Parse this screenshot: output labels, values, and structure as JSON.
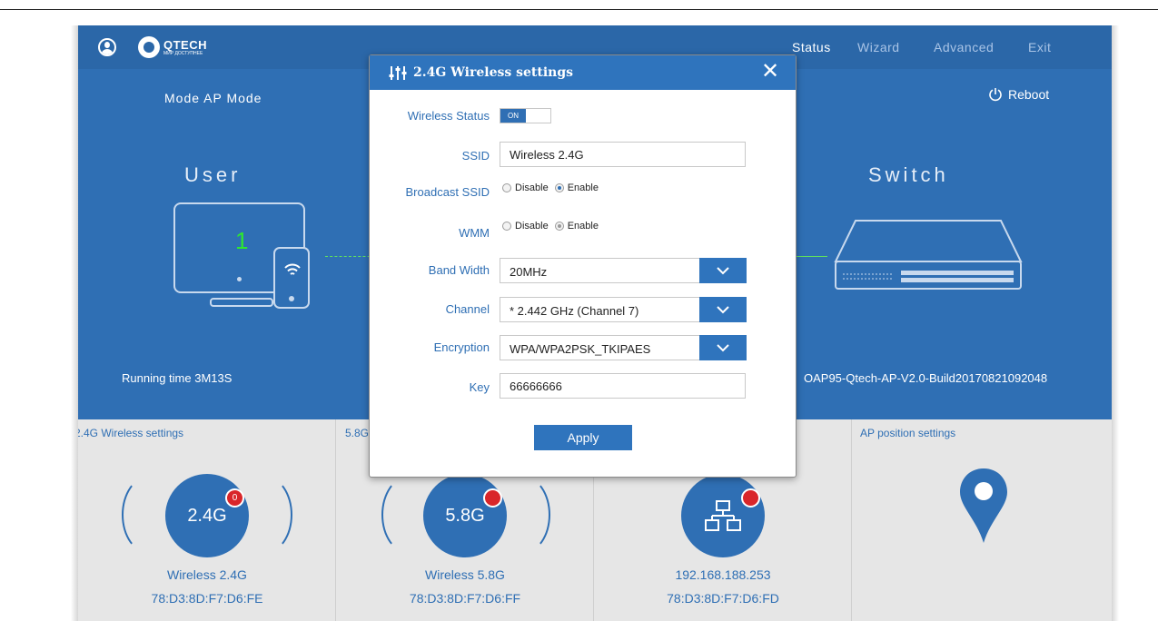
{
  "header": {
    "logo_text": "QTECH",
    "logo_slogan": "МИР ДОСТУПНЕЕ",
    "nav": [
      "Status",
      "Wizard",
      "Advanced",
      "Exit"
    ],
    "active_nav": "Status"
  },
  "status": {
    "mode_label": "Mode  AP Mode",
    "reboot_label": "Reboot",
    "user_title": "User",
    "switch_title": "Switch",
    "user_count": "1",
    "running_time": "Running time  3M13S",
    "firmware": "OAP95-Qtech-AP-V2.0-Build20170821092048"
  },
  "panels": [
    {
      "title": "2.4G Wireless settings",
      "circle": "2.4G",
      "badge": "0",
      "name": "Wireless 2.4G",
      "mac": "78:D3:8D:F7:D6:FE"
    },
    {
      "title": "5.8G",
      "circle": "5.8G",
      "name": "Wireless 5.8G",
      "mac": "78:D3:8D:F7:D6:FF"
    },
    {
      "name": "192.168.188.253",
      "mac": "78:D3:8D:F7:D6:FD"
    },
    {
      "title": "AP position settings"
    }
  ],
  "modal": {
    "title": "2.4G Wireless settings",
    "close_glyph": "✕",
    "wireless_status_label": "Wireless Status",
    "wireless_status_value": "ON",
    "ssid_label": "SSID",
    "ssid_value": "Wireless 2.4G",
    "broadcast_label": "Broadcast SSID",
    "broadcast_options": [
      "Disable",
      "Enable"
    ],
    "broadcast_selected": "Enable",
    "wmm_label": "WMM",
    "wmm_options": [
      "Disable",
      "Enable"
    ],
    "wmm_selected": "Enable",
    "bandwidth_label": "Band Width",
    "bandwidth_value": "20MHz",
    "channel_label": "Channel",
    "channel_value": "* 2.442 GHz (Channel 7)",
    "encryption_label": "Encryption",
    "encryption_value": "WPA/WPA2PSK_TKIPAES",
    "key_label": "Key",
    "key_value": "66666666",
    "apply_label": "Apply"
  },
  "colors": {
    "primary_blue": "#2f6fb4",
    "header_blue": "#2b67a8",
    "badge_red": "#d9262a",
    "link_green": "#2ee82e"
  },
  "icons": [
    "user-circle-icon",
    "logo-icon",
    "power-icon",
    "monitor-icon",
    "phone-wifi-icon",
    "switch-icon",
    "sliders-icon",
    "close-icon",
    "chevron-down-icon",
    "network-icon",
    "location-pin-icon"
  ]
}
